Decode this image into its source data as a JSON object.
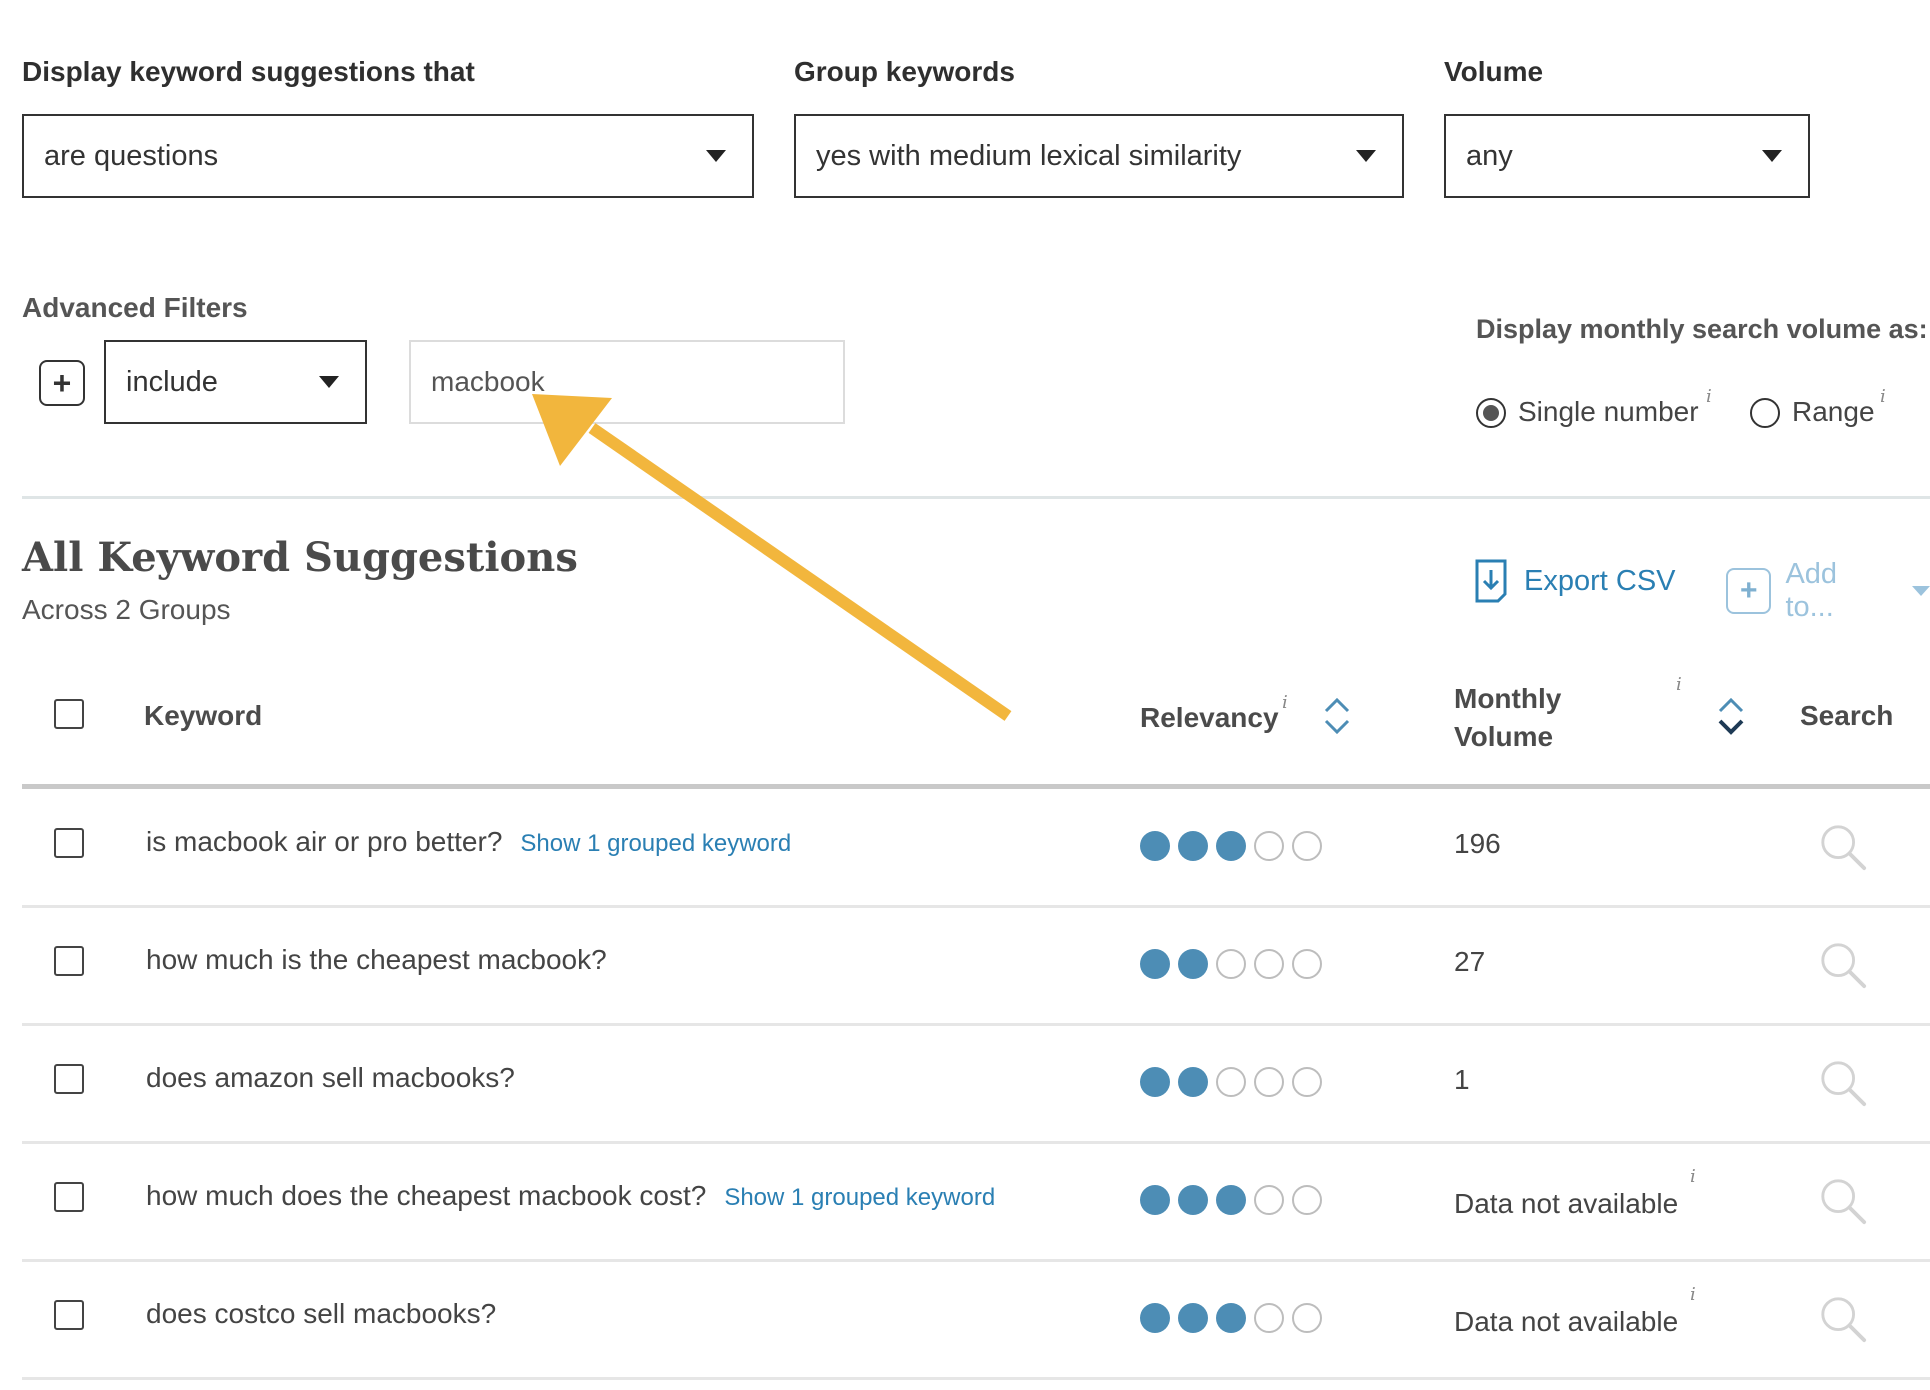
{
  "filters": {
    "suggestions_label": "Display keyword suggestions that",
    "suggestions_value": "are questions",
    "group_label": "Group keywords",
    "group_value": "yes with medium lexical similarity",
    "volume_label": "Volume",
    "volume_value": "any"
  },
  "advanced": {
    "label": "Advanced Filters",
    "mode_value": "include",
    "term_value": "macbook"
  },
  "display_volume": {
    "label": "Display monthly search volume as:",
    "option_single": "Single number",
    "option_range": "Range",
    "selected": "Single number",
    "info_glyph": "i"
  },
  "section": {
    "title": "All Keyword Suggestions",
    "subtitle": "Across 2 Groups",
    "export_label": "Export CSV",
    "add_to_label": "Add to..."
  },
  "table": {
    "headers": {
      "keyword": "Keyword",
      "relevancy": "Relevancy",
      "monthly_volume_line1": "Monthly",
      "monthly_volume_line2": "Volume",
      "search": "Search"
    },
    "rows": [
      {
        "keyword": "is macbook air or pro better?",
        "group_link": "Show 1 grouped keyword",
        "relevancy": 3,
        "volume": "196"
      },
      {
        "keyword": "how much is the cheapest macbook?",
        "group_link": "",
        "relevancy": 2,
        "volume": "27"
      },
      {
        "keyword": "does amazon sell macbooks?",
        "group_link": "",
        "relevancy": 2,
        "volume": "1"
      },
      {
        "keyword": "how much does the cheapest macbook cost?",
        "group_link": "Show 1 grouped keyword",
        "relevancy": 3,
        "volume": "Data not available"
      },
      {
        "keyword": "does costco sell macbooks?",
        "group_link": "",
        "relevancy": 3,
        "volume": "Data not available"
      }
    ],
    "relevancy_max": 5
  },
  "colors": {
    "accent": "#2a7fb3",
    "dot_filled": "#4d8db5",
    "arrow": "#f2b63d"
  }
}
